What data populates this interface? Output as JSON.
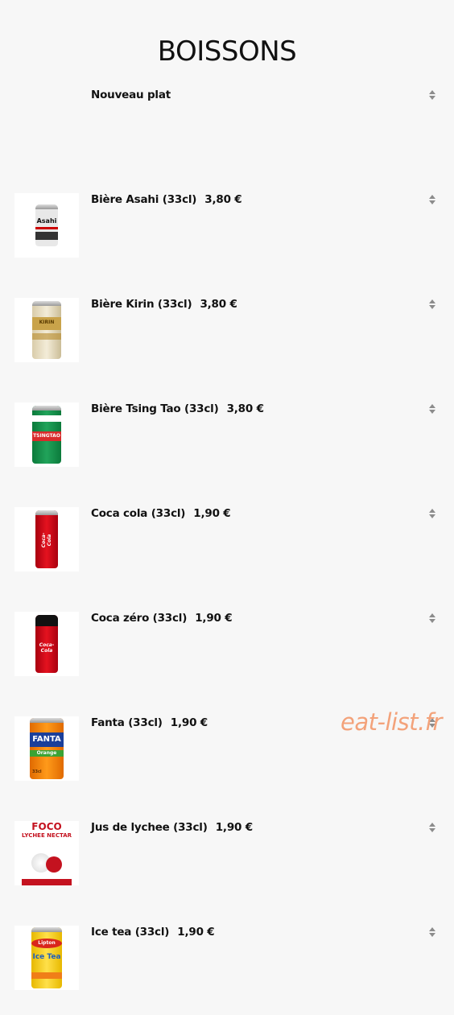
{
  "title": "BOISSONS",
  "new_item": {
    "label": "Nouveau plat"
  },
  "items": [
    {
      "name": "Bière Asahi (33cl)",
      "price": "3,80 €",
      "image": "asahi-can",
      "can_text": "Asahi"
    },
    {
      "name": "Bière Kirin (33cl)",
      "price": "3,80 €",
      "image": "kirin-can",
      "can_text": "KIRIN"
    },
    {
      "name": "Bière Tsing Tao (33cl)",
      "price": "3,80 €",
      "image": "tsingtao-can",
      "can_text": "TSINGTAO"
    },
    {
      "name": "Coca cola (33cl)",
      "price": "1,90 €",
      "image": "coca-cola-can",
      "can_text": "Coca-Cola"
    },
    {
      "name": "Coca zéro (33cl)",
      "price": "1,90 €",
      "image": "coca-zero-can",
      "can_text": "Coca-Cola"
    },
    {
      "name": "Fanta (33cl)",
      "price": "1,90 €",
      "image": "fanta-can",
      "can_text": "FANTA",
      "can_text2": "Orange",
      "can_text3": "33cl"
    },
    {
      "name": "Jus de lychee (33cl)",
      "price": "1,90 €",
      "image": "lychee-can",
      "can_text": "FOCO",
      "can_text2": "LYCHEE NECTAR"
    },
    {
      "name": "Ice tea (33cl)",
      "price": "1,90 €",
      "image": "ice-tea-can",
      "can_text": "Lipton",
      "can_text2": "Ice Tea"
    }
  ],
  "watermark": "eat-list.fr",
  "colors": {
    "background": "#f7f7f7",
    "watermark": "#f3a27a",
    "sort_icon": "#8c8c8c"
  }
}
